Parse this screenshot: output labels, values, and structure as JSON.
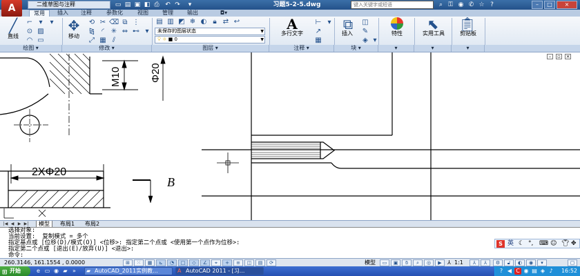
{
  "titlebar": {
    "workspace": "二维草图与注释",
    "document_title": "习题5-2-5.dwg",
    "search_placeholder": "键入关键字或短语",
    "window_controls": [
      "–",
      "□",
      "×"
    ]
  },
  "ribbon": {
    "tabs": [
      "常用",
      "插入",
      "注释",
      "参数化",
      "视图",
      "管理",
      "输出"
    ],
    "active_tab": "常用",
    "panels": {
      "draw": {
        "title": "绘图",
        "line_label": "直线"
      },
      "modify": {
        "title": "修改",
        "move_label": "移动"
      },
      "layers": {
        "title": "图层",
        "layer_state": "未保存的图层状态",
        "current_layer": "0"
      },
      "annotation": {
        "title": "注释",
        "mtext_label": "多行文字"
      },
      "block": {
        "title": "块",
        "insert_label": "插入"
      },
      "properties": {
        "title": "",
        "label": "特性"
      },
      "utilities": {
        "label": "实用工具"
      },
      "clipboard": {
        "label": "剪贴板"
      }
    }
  },
  "drawing": {
    "dim_m10": "M10",
    "dim_phi20": "Φ20",
    "dim_2xphi20": "2XΦ20",
    "section_label": "B"
  },
  "layout_tabs": [
    "模型",
    "布局1",
    "布局2"
  ],
  "command": {
    "lines": [
      "选择对象:",
      "当前设置:  复制模式 = 多个",
      "指定基点或 [位移(D)/模式(O)] <位移>: 指定第二个点或 <使用第一个点作为位移>:",
      "指定第二个点或 [退出(E)/放弃(U)] <退出>:",
      "命令:"
    ]
  },
  "ime": {
    "label": "英"
  },
  "status": {
    "coordinates": "260.3146, 161.1554 , 0.0000",
    "model_label": "模型",
    "scale": "1:1"
  },
  "taskbar": {
    "start_label": "开始",
    "tasks": [
      "AutoCAD_2011实例教...",
      "AutoCAD 2011 - [习..."
    ],
    "clock": "16:52"
  }
}
